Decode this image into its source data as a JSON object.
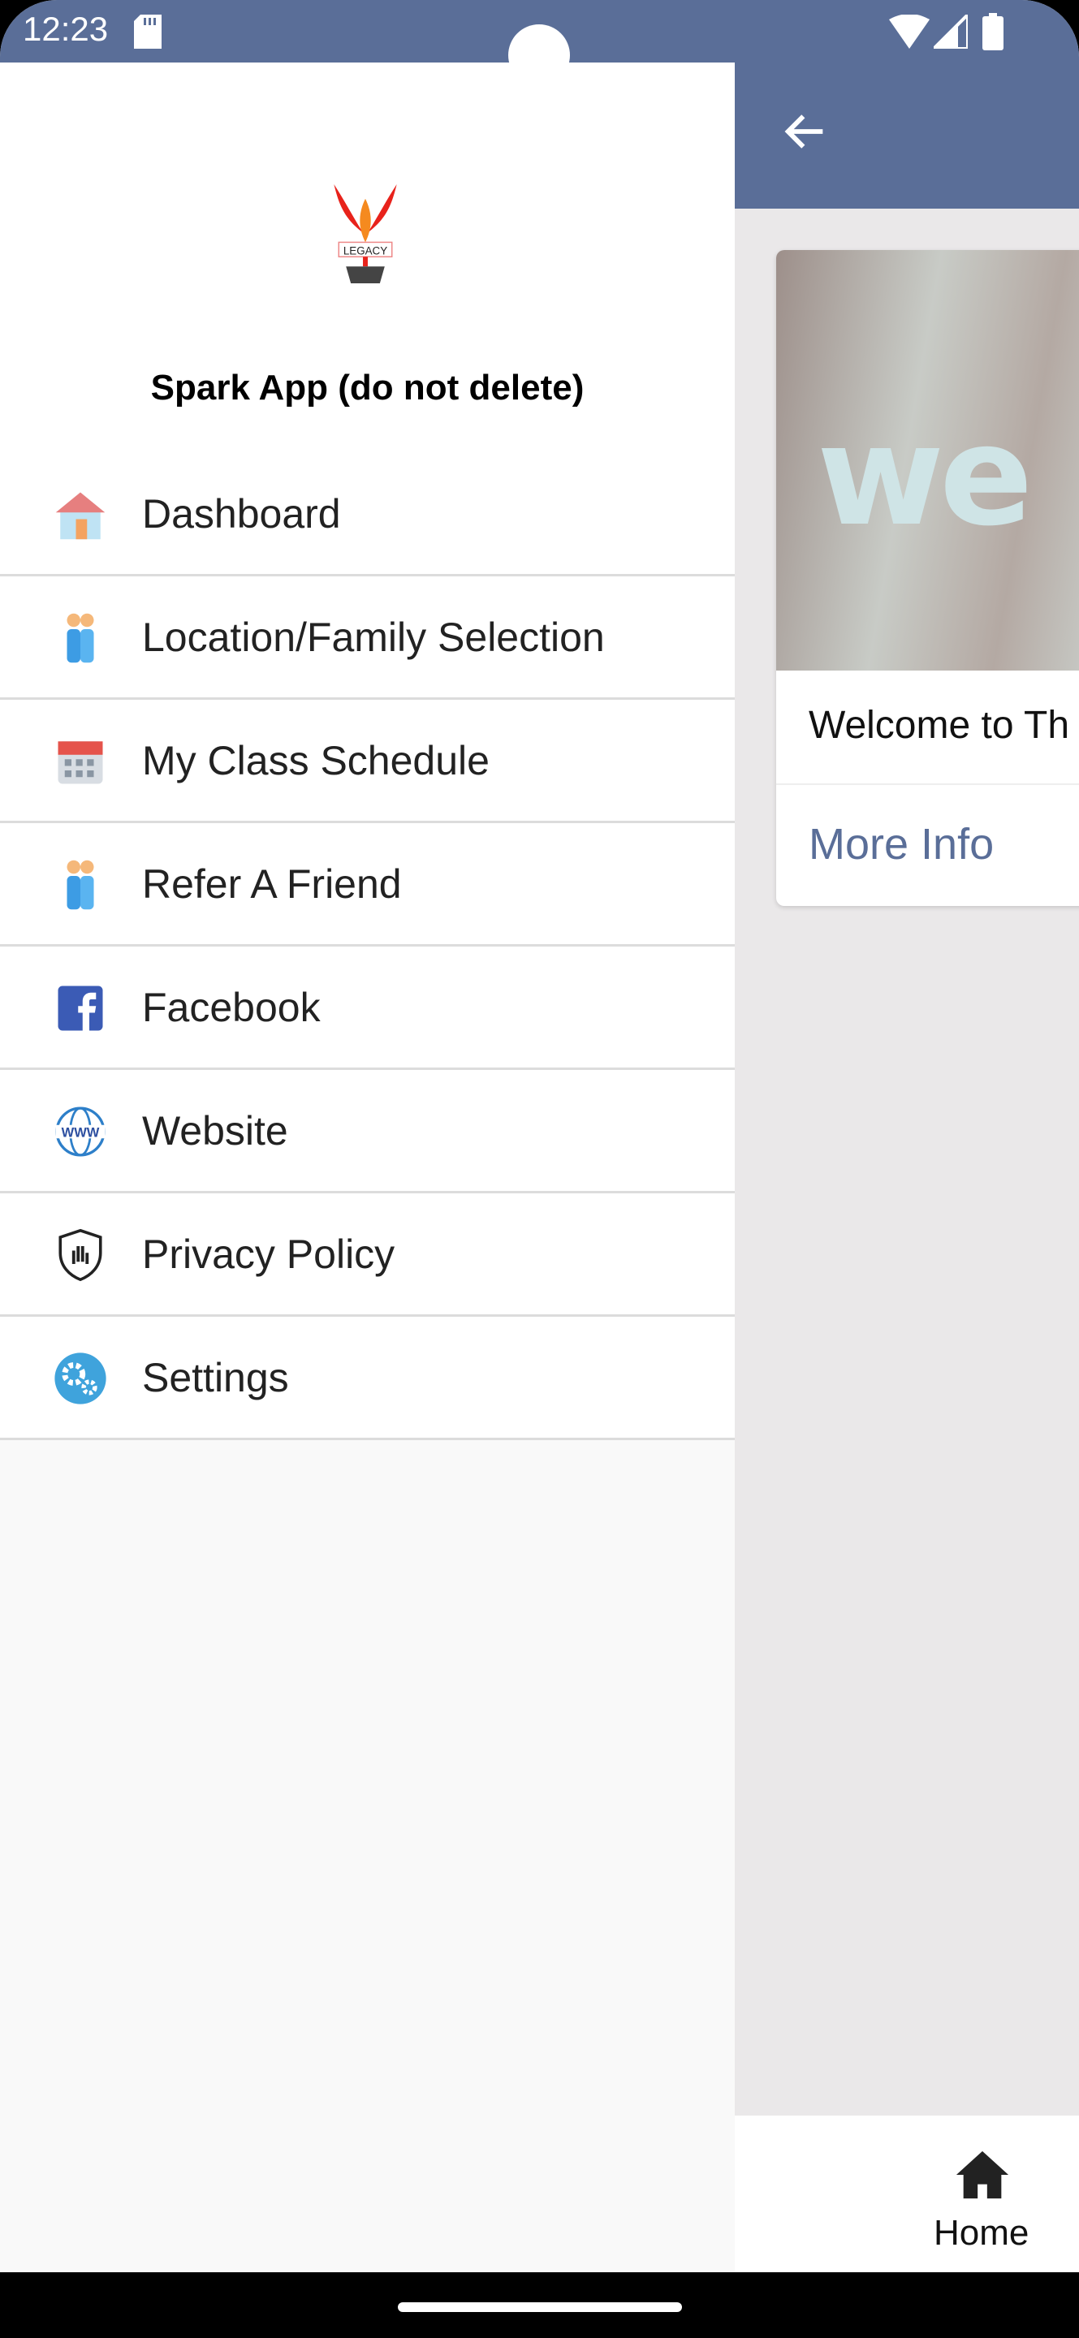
{
  "status_bar": {
    "time": "12:23",
    "icons": [
      "sd-card-icon",
      "wifi-icon",
      "signal-icon",
      "battery-icon"
    ]
  },
  "colors": {
    "primary": "#5a6e98",
    "drawer_bg": "#f9f9f9",
    "content_bg": "#eae8e9"
  },
  "drawer": {
    "logo_text": "LEGACY ACADEMY",
    "title": "Spark App (do not delete)",
    "items": [
      {
        "label": "Dashboard",
        "icon": "house-icon"
      },
      {
        "label": "Location/Family Selection",
        "icon": "family-icon"
      },
      {
        "label": "My Class Schedule",
        "icon": "calendar-icon"
      },
      {
        "label": "Refer A Friend",
        "icon": "family-icon"
      },
      {
        "label": "Facebook",
        "icon": "facebook-icon"
      },
      {
        "label": "Website",
        "icon": "globe-www-icon"
      },
      {
        "label": "Privacy Policy",
        "icon": "shield-hand-icon"
      },
      {
        "label": "Settings",
        "icon": "gears-icon"
      }
    ]
  },
  "main": {
    "card": {
      "image_text": "we",
      "title": "Welcome to Th",
      "link": "More Info"
    },
    "tabbar": {
      "home_label": "Home"
    }
  }
}
